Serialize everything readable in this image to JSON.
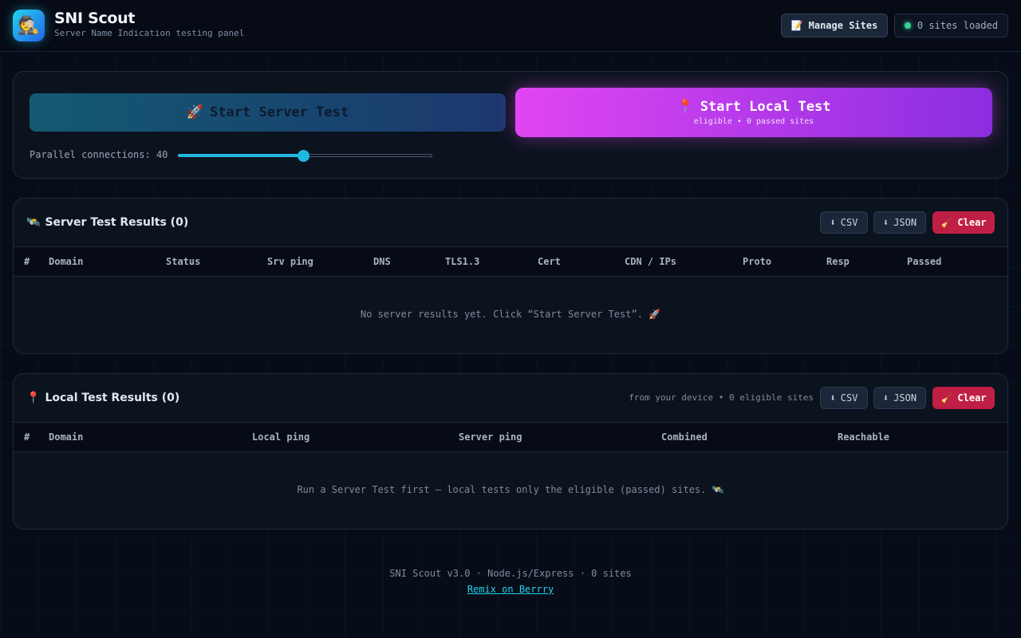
{
  "app": {
    "title": "SNI Scout",
    "subtitle": "Server Name Indication testing panel",
    "logo_icon": "🕵️"
  },
  "header": {
    "manage_sites": {
      "icon": "📝",
      "label": "Manage Sites"
    },
    "sites_status": "0 sites loaded"
  },
  "controls": {
    "server_test": {
      "icon": "🚀",
      "label": "Start Server Test"
    },
    "local_test": {
      "icon": "📍",
      "label": "Start Local Test",
      "sublabel": "eligible • 0 passed sites"
    },
    "parallel": {
      "label": "Parallel connections:",
      "value": 40,
      "min": 1,
      "max": 80
    }
  },
  "server_results": {
    "icon": "🛰️",
    "title": "Server Test Results (0)",
    "buttons": {
      "csv": "CSV",
      "json": "JSON",
      "clear": "Clear",
      "download_icon": "⬇",
      "clear_icon": "🧹"
    },
    "columns": [
      "#",
      "Domain",
      "Status",
      "Srv ping",
      "DNS",
      "TLS1.3",
      "Cert",
      "CDN / IPs",
      "Proto",
      "Resp",
      "Passed"
    ],
    "empty": "No server results yet. Click “Start Server Test”. 🚀"
  },
  "local_results": {
    "icon": "📍",
    "title": "Local Test Results (0)",
    "note": "from your device • 0 eligible sites",
    "buttons": {
      "csv": "CSV",
      "json": "JSON",
      "clear": "Clear",
      "download_icon": "⬇",
      "clear_icon": "🧹"
    },
    "columns": [
      "#",
      "Domain",
      "Local ping",
      "Server ping",
      "Combined",
      "Reachable"
    ],
    "empty": "Run a Server Test first — local tests only the eligible (passed) sites. 🛰️"
  },
  "footer": {
    "text": "SNI Scout v3.0 · Node.js/Express · 0 sites",
    "link": "Remix on Berrry"
  },
  "colors": {
    "accent_cyan": "#22d3ee",
    "accent_magenta": "#d946ef",
    "danger": "#c01f45",
    "status_ok": "#34d399"
  }
}
